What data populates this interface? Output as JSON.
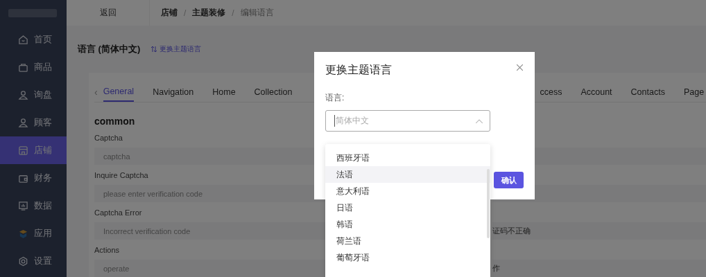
{
  "topbar": {
    "back": "返回",
    "separator": "/",
    "breadcrumb": [
      {
        "label": "店铺",
        "current": false
      },
      {
        "label": "主题装修",
        "current": false
      },
      {
        "label": "编辑语言",
        "current": true
      }
    ]
  },
  "sidebar": {
    "items": [
      {
        "label": "首页",
        "selected": false
      },
      {
        "label": "商品",
        "selected": false
      },
      {
        "label": "询盘",
        "selected": false
      },
      {
        "label": "顾客",
        "selected": false
      },
      {
        "label": "店铺",
        "selected": true
      },
      {
        "label": "财务",
        "selected": false
      },
      {
        "label": "数据",
        "selected": false
      },
      {
        "label": "应用",
        "selected": false
      },
      {
        "label": "设置",
        "selected": false
      }
    ]
  },
  "page": {
    "title": "语言 (简体中文)",
    "change_link": "更换主题语言"
  },
  "tabs_scroll_left": "‹",
  "tabs": [
    {
      "label": "General",
      "selected": true
    },
    {
      "label": "Navigation",
      "selected": false
    },
    {
      "label": "Home",
      "selected": false
    },
    {
      "label": "Collection",
      "selected": false
    },
    {
      "label": "ccess",
      "selected": false
    },
    {
      "label": "Account",
      "selected": false
    },
    {
      "label": "Contacts",
      "selected": false
    },
    {
      "label": "Page",
      "selected": false
    }
  ],
  "section": "common",
  "fields": [
    {
      "label": "Captcha",
      "placeholder": "captcha"
    },
    {
      "label": "Inquire Captcha",
      "placeholder": "please enter verification code"
    },
    {
      "label": "Captcha Error",
      "placeholder": "Incorrect verification code",
      "value": "证码不正确"
    },
    {
      "label": "Actions",
      "placeholder": "operate",
      "value": "作"
    }
  ],
  "dialog": {
    "title": "更换主题语言",
    "label": "语言:",
    "select_placeholder": "简体中文",
    "confirm": "确认",
    "options": [
      {
        "label": "西班牙语",
        "selected": false
      },
      {
        "label": "法语",
        "selected": true
      },
      {
        "label": "意大利语",
        "selected": false
      },
      {
        "label": "日语",
        "selected": false
      },
      {
        "label": "韩语",
        "selected": false
      },
      {
        "label": "荷兰语",
        "selected": false
      },
      {
        "label": "葡萄牙语",
        "selected": false
      }
    ]
  }
}
